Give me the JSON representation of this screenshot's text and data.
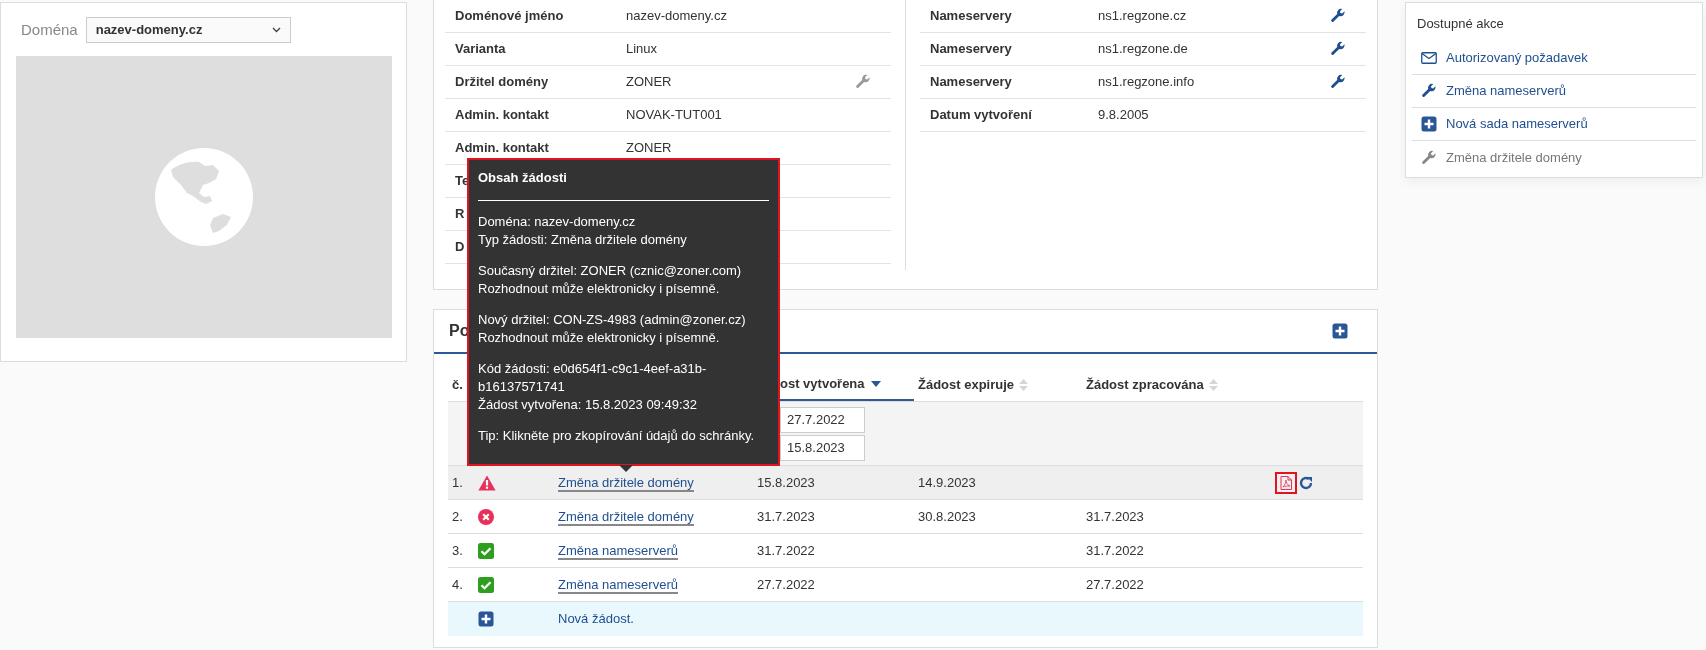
{
  "domain_selector": {
    "label": "Doména",
    "value": "nazev-domeny.cz"
  },
  "preview": {
    "kind": "globe"
  },
  "details_left": [
    {
      "label": "Doménové jméno",
      "value": "nazev-domeny.cz"
    },
    {
      "label": "Varianta",
      "value": "Linux"
    },
    {
      "label": "Držitel domény",
      "value": "ZONER",
      "edit": {
        "enabled": false
      }
    },
    {
      "label": "Admin. kontakt",
      "value": "NOVAK-TUT001"
    },
    {
      "label": "Admin. kontakt",
      "value": "ZONER"
    },
    {
      "label": "Te"
    },
    {
      "label": "R"
    },
    {
      "label": "D"
    }
  ],
  "details_right": [
    {
      "label": "Nameservery",
      "value": "ns1.regzone.cz",
      "edit": {
        "enabled": true
      }
    },
    {
      "label": "Nameservery",
      "value": "ns1.regzone.de",
      "edit": {
        "enabled": true
      }
    },
    {
      "label": "Nameservery",
      "value": "ns1.regzone.info",
      "edit": {
        "enabled": true
      }
    },
    {
      "label": "Datum vytvoření",
      "value": "9.8.2005"
    }
  ],
  "requests": {
    "title": "Po",
    "columns": [
      {
        "label": "č."
      },
      {
        "label": "ost vytvořena",
        "kind": "sorted"
      },
      {
        "label": "Žádost expiruje",
        "kind": "sortable"
      },
      {
        "label": "Žádost zpracována",
        "kind": "sortable"
      }
    ],
    "filters": [
      "27.7.2022",
      "15.8.2023"
    ],
    "rows": [
      {
        "number": "1.",
        "kind": "warning",
        "type": "Změna držitele domény",
        "created": "15.8.2023",
        "expires": "14.9.2023",
        "selected": true,
        "actions": true
      },
      {
        "number": "2.",
        "kind": "error",
        "type": "Změna držitele domény",
        "created": "31.7.2023",
        "expires": "30.8.2023",
        "processed": "31.7.2023",
        "selected": false
      },
      {
        "number": "3.",
        "kind": "ok",
        "type": "Změna nameserverů",
        "created": "31.7.2022",
        "processed": "31.7.2022",
        "selected": false
      },
      {
        "number": "4.",
        "kind": "ok",
        "type": "Změna nameserverů",
        "created": "27.7.2022",
        "processed": "27.7.2022",
        "selected": false
      }
    ],
    "new_request": "Nová žádost."
  },
  "tooltip": {
    "title": "Obsah žádosti",
    "paragraphs": [
      [
        "Doména: nazev-domeny.cz",
        "Typ žádosti: Změna držitele domény"
      ],
      [
        "Současný držitel: ZONER (cznic@zoner.com)",
        "Rozhodnout může elektronicky i písemně."
      ],
      [
        "Nový držitel: CON-ZS-4983 (admin@zoner.cz)",
        "Rozhodnout může elektronicky i písemně."
      ],
      [
        "Kód žádosti: e0d654f1-c9c1-4eef-a31b-b16137571741",
        "Žádost vytvořena: 15.8.2023 09:49:32"
      ],
      [
        "Tip: Klikněte pro zkopírování údajů do schránky."
      ]
    ]
  },
  "actions": {
    "title": "Dostupné akce",
    "items": [
      {
        "label": "Autorizovaný požadavek",
        "kind": "mail",
        "disabled": false
      },
      {
        "label": "Změna nameserverů",
        "kind": "wrench",
        "disabled": false
      },
      {
        "label": "Nová sada nameserverů",
        "kind": "plus",
        "disabled": false
      },
      {
        "label": "Změna držitele domény",
        "kind": "wrench",
        "disabled": true
      }
    ]
  }
}
